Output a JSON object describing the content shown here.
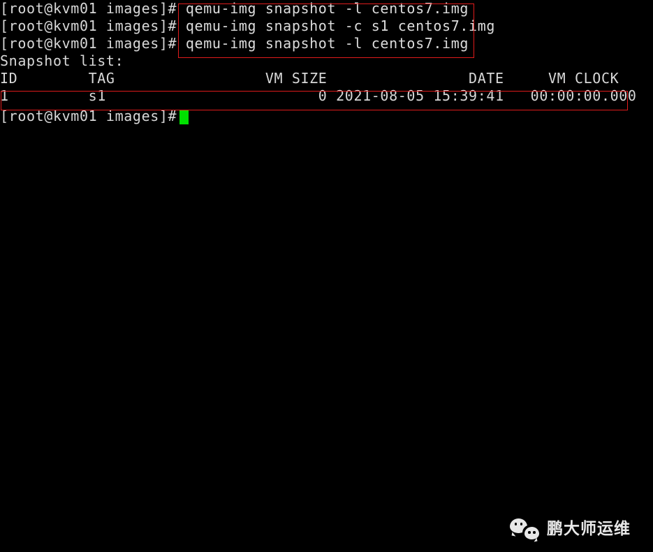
{
  "terminal": {
    "prompt": "[root@kvm01 images]# ",
    "lines": [
      {
        "type": "command",
        "prompt": "[root@kvm01 images]# ",
        "command": "qemu-img snapshot -l centos7.img"
      },
      {
        "type": "command",
        "prompt": "[root@kvm01 images]# ",
        "command": "qemu-img snapshot -c s1 centos7.img"
      },
      {
        "type": "command",
        "prompt": "[root@kvm01 images]# ",
        "command": "qemu-img snapshot -l centos7.img"
      },
      {
        "type": "output",
        "text": "Snapshot list:"
      },
      {
        "type": "output",
        "text": "ID        TAG                 VM SIZE                DATE     VM CLOCK"
      },
      {
        "type": "output",
        "text": "1         s1                        0 2021-08-05 15:39:41   00:00:00.000"
      },
      {
        "type": "prompt",
        "prompt": "[root@kvm01 images]# ",
        "command": ""
      }
    ],
    "snapshot_table": {
      "title": "Snapshot list:",
      "columns": [
        "ID",
        "TAG",
        "VM SIZE",
        "DATE",
        "VM CLOCK"
      ],
      "rows": [
        {
          "id": "1",
          "tag": "s1",
          "vm_size": "0",
          "date": "2021-08-05 15:39:41",
          "vm_clock": "00:00:00.000"
        }
      ]
    },
    "colors": {
      "background": "#000000",
      "foreground": "#d8d8d8",
      "cursor": "#00e000",
      "annotation": "#e01b1b"
    },
    "cursor": {
      "label": "block-cursor",
      "visible": true
    }
  },
  "annotations": [
    {
      "name": "commands-highlight-box",
      "label": "red box around the three qemu-img snapshot commands"
    },
    {
      "name": "snapshot-row-highlight-box",
      "label": "red box around the snapshot result row"
    }
  ],
  "watermark": {
    "icon": "wechat-icon",
    "text": "鹏大师运维"
  }
}
